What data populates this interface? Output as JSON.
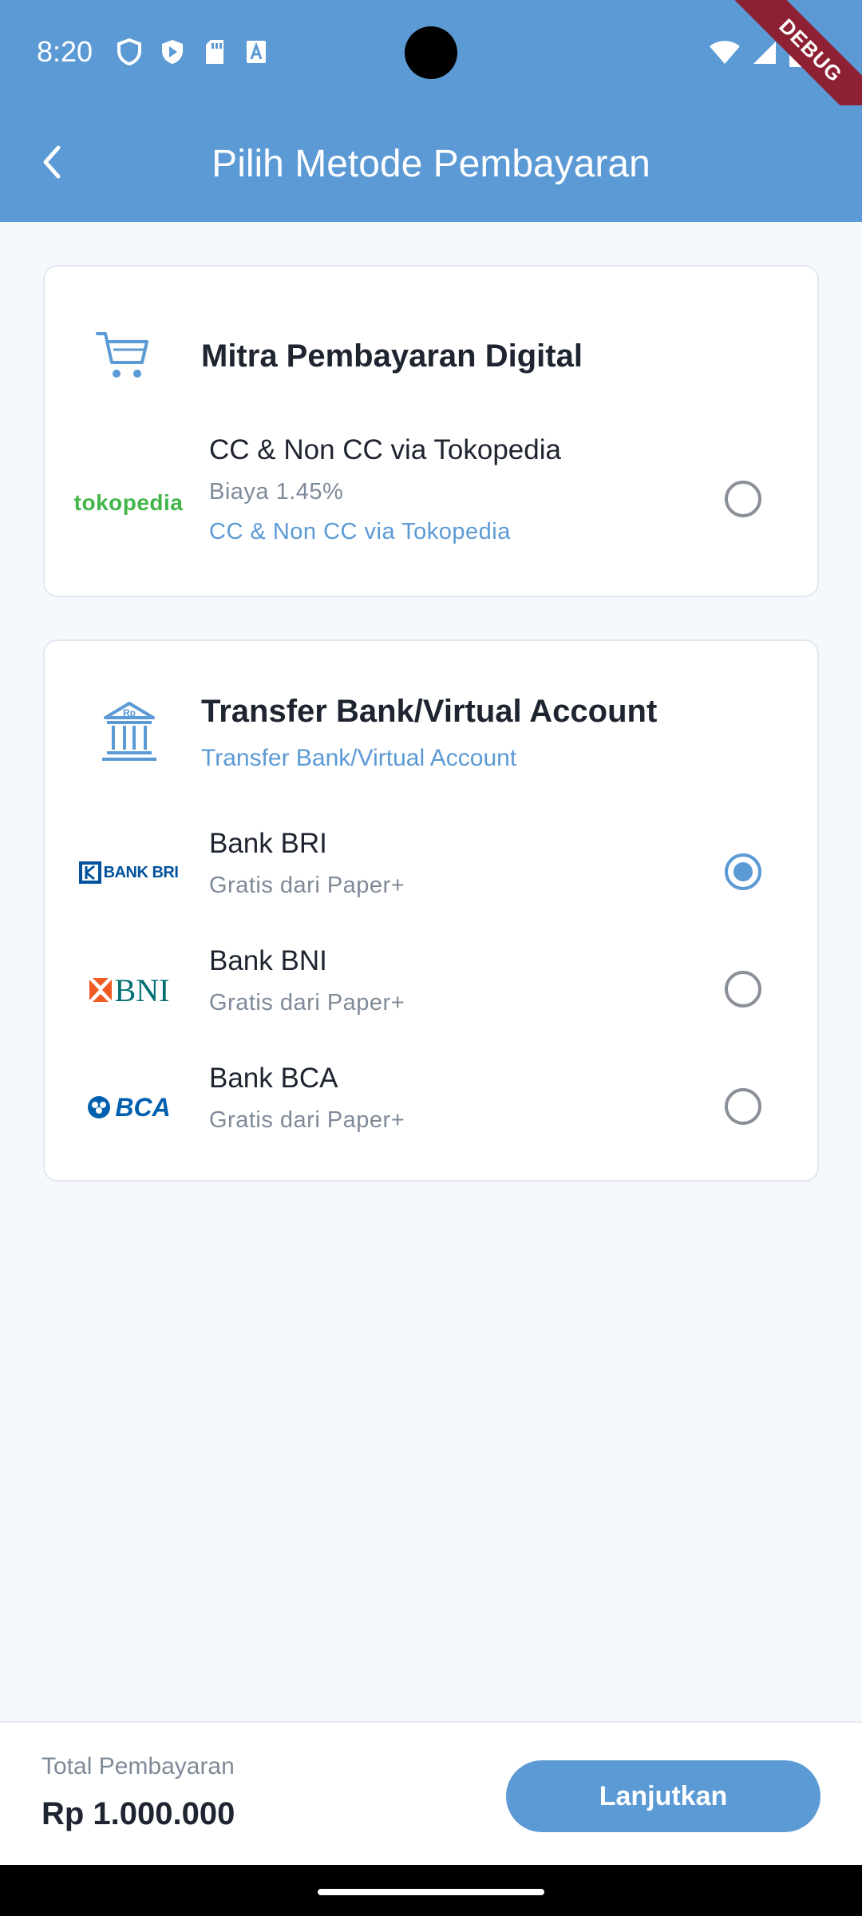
{
  "status_bar": {
    "time": "8:20"
  },
  "debug_label": "DEBUG",
  "app_bar": {
    "title": "Pilih Metode Pembayaran"
  },
  "digital_section": {
    "title": "Mitra Pembayaran Digital",
    "items": [
      {
        "logo_text": "tokopedia",
        "title": "CC & Non CC via Tokopedia",
        "subtitle": "Biaya 1.45%",
        "note": "CC & Non CC via Tokopedia",
        "selected": false
      }
    ]
  },
  "bank_section": {
    "title": "Transfer Bank/Virtual Account",
    "subtitle": "Transfer Bank/Virtual Account",
    "icon_text": "Rp",
    "items": [
      {
        "logo_text": "BANK BRI",
        "title": "Bank BRI",
        "subtitle": "Gratis dari Paper+",
        "selected": true
      },
      {
        "logo_text": "BNI",
        "title": "Bank BNI",
        "subtitle": "Gratis dari Paper+",
        "selected": false
      },
      {
        "logo_text": "BCA",
        "title": "Bank BCA",
        "subtitle": "Gratis dari Paper+",
        "selected": false
      }
    ]
  },
  "footer": {
    "total_label": "Total Pembayaran",
    "total_value": "Rp 1.000.000",
    "cta_label": "Lanjutkan"
  },
  "colors": {
    "primary": "#5B9AD5",
    "text_dark": "#1E2430",
    "text_muted": "#7F8A99",
    "background": "#F5F8FC",
    "tokopedia": "#42B549",
    "bri": "#00529C",
    "bni_teal": "#006E73",
    "bni_orange": "#F15A23",
    "bca": "#0060AF"
  }
}
